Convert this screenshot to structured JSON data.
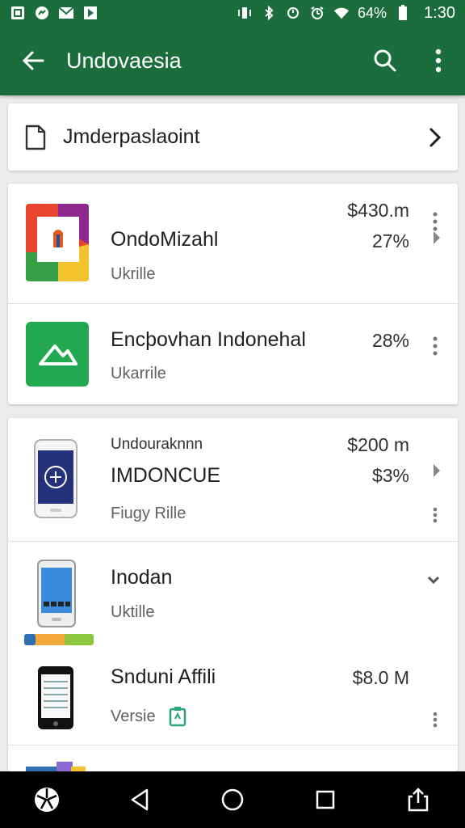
{
  "status_bar": {
    "battery_percent": "64%",
    "time": "1:30",
    "left_icons": [
      "photo-icon",
      "messenger-icon",
      "mail-icon",
      "play-icon"
    ],
    "right_icons": [
      "vibrate-icon",
      "bluetooth-icon",
      "sync-icon",
      "alarm-icon",
      "wifi-icon",
      "battery-icon"
    ]
  },
  "app_bar": {
    "title": "Undovaesia",
    "color": "#1b6e3b"
  },
  "file_card": {
    "title": "Jmderpaslaoint"
  },
  "group_1": {
    "items": [
      {
        "title": "OndoMizahl",
        "subtitle": "Ukrille",
        "amount": "$430.m",
        "percent": "27%"
      },
      {
        "title": "Encþovhan Indonehal",
        "subtitle": "Ukarrile",
        "percent": "28%"
      }
    ]
  },
  "group_2": {
    "items": [
      {
        "line1": "Undouraknnn",
        "title": "IMDONCUE",
        "subtitle": "Fiugy Rille",
        "amount": "$200 m",
        "percent": "$3%"
      },
      {
        "title": "Inodan",
        "subtitle": "Uktille"
      },
      {
        "title": "Snduni Affili",
        "subtitle": "Versie",
        "amount": "$8.0 M"
      }
    ]
  }
}
